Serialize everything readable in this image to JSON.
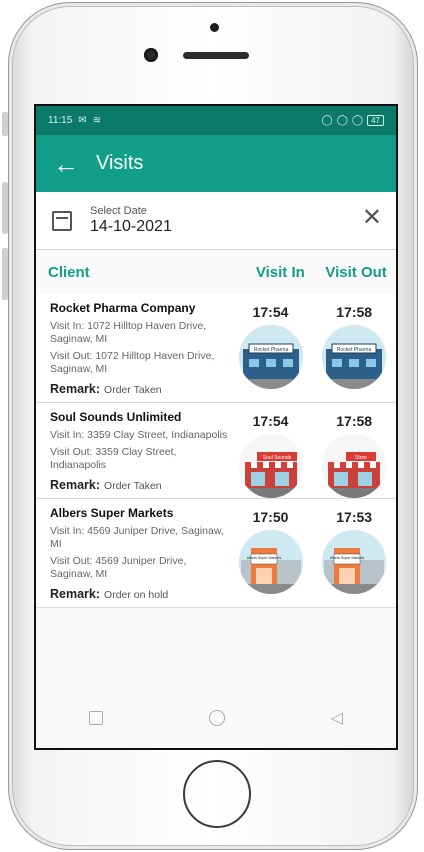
{
  "status_bar": {
    "time": "11:15",
    "battery": "47"
  },
  "app_bar": {
    "title": "Visits"
  },
  "date_filter": {
    "label": "Select Date",
    "value": "14-10-2021"
  },
  "columns": {
    "client": "Client",
    "visit_in": "Visit In",
    "visit_out": "Visit Out"
  },
  "remark_label": "Remark:",
  "visits": [
    {
      "client": "Rocket Pharma Company",
      "visit_in_address": "Visit In: 1072 Hilltop Haven Drive, Saginaw, MI",
      "visit_out_address": "Visit Out: 1072 Hilltop Haven Drive, Saginaw, MI",
      "remark": "Order Taken",
      "in_time": "17:54",
      "out_time": "17:58",
      "in_sign": "Rocket Pharma",
      "out_sign": "Rocket Pharma"
    },
    {
      "client": "Soul Sounds Unlimited",
      "visit_in_address": "Visit In: 3359 Clay Street, Indianapolis",
      "visit_out_address": "Visit Out: 3359 Clay Street, Indianapolis",
      "remark": "Order Taken",
      "in_time": "17:54",
      "out_time": "17:58",
      "in_sign": "Soul Sounds",
      "out_sign": "Store"
    },
    {
      "client": "Albers Super Markets",
      "visit_in_address": "Visit In: 4569 Juniper Drive, Saginaw, MI",
      "visit_out_address": "Visit Out: 4569 Juniper Drive, Saginaw, MI",
      "remark": "Order on hold",
      "in_time": "17:50",
      "out_time": "17:53",
      "in_sign": "Albers Super Markets",
      "out_sign": "Albers Super Markets"
    }
  ],
  "colors": {
    "primary": "#119e88",
    "status_bar": "#0b7a6a"
  }
}
